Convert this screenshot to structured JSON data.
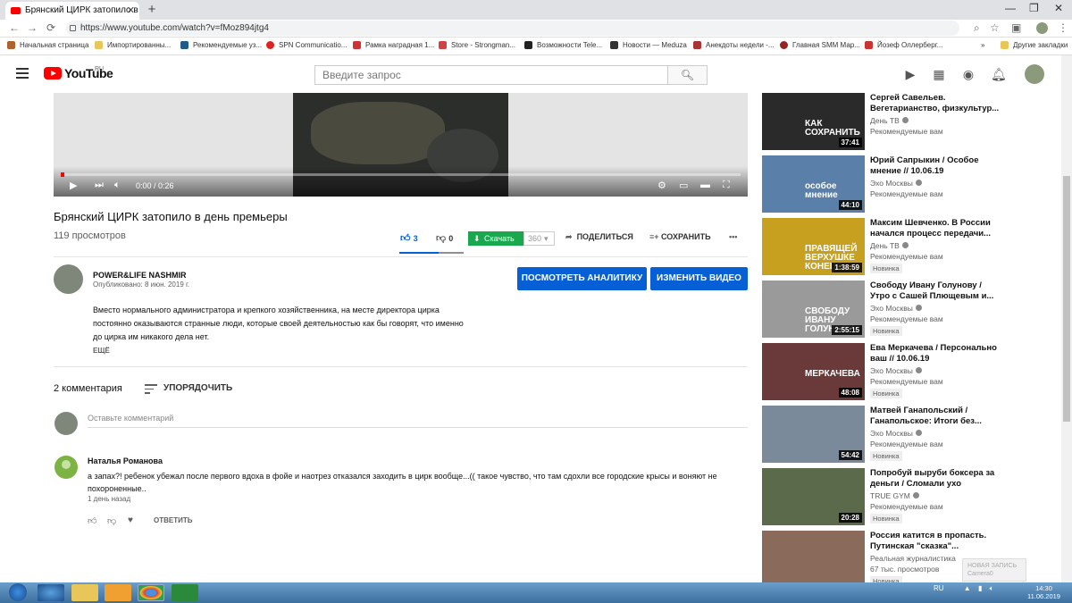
{
  "browser": {
    "tab_title": "Брянский ЦИРК затопило в день",
    "url": "https://www.youtube.com/watch?v=fMoz894jtg4",
    "bookmarks": [
      {
        "label": "Начальная страница",
        "color": "#b0622c"
      },
      {
        "label": "Импортированны...",
        "color": "#e8c65a"
      },
      {
        "label": "Рекомендуемые уз...",
        "color": "#1e5a8a"
      },
      {
        "label": "SPN Communicatio...",
        "color": "#d22"
      },
      {
        "label": "Рамка наградная 1...",
        "color": "#c33"
      },
      {
        "label": "Store - Strongman...",
        "color": "#c44"
      },
      {
        "label": "Возможности Tele...",
        "color": "#222"
      },
      {
        "label": "Новости — Meduza",
        "color": "#333"
      },
      {
        "label": "Анекдоты недели -...",
        "color": "#a33"
      },
      {
        "label": "Главная SMM Мар...",
        "color": "#922"
      },
      {
        "label": "Йозеф Оллерберг...",
        "color": "#c33"
      }
    ],
    "other_bookmarks": "Другие закладки"
  },
  "youtube": {
    "logo_text": "YouTube",
    "logo_region": "RU",
    "search_placeholder": "Введите запрос"
  },
  "player": {
    "time": "0:00 / 0:26",
    "progress_fraction": 0.0
  },
  "video": {
    "title": "Брянский ЦИРК затопило в день премьеры",
    "views": "119 просмотров",
    "likes": "3",
    "dislikes": "0",
    "download_label": "Скачать",
    "quality": "360",
    "share_label": "ПОДЕЛИТЬСЯ",
    "save_label": "СОХРАНИТЬ",
    "more_label": "•••"
  },
  "channel": {
    "name": "POWER&LIFE NASHMIR",
    "published": "Опубликовано: 8 июн. 2019 г.",
    "analytics_button": "ПОСМОТРЕТЬ АНАЛИТИКУ",
    "edit_button": "ИЗМЕНИТЬ ВИДЕО",
    "description": "Вместо нормального администратора и крепкого хозяйственника, на месте директора цирка постоянно оказываются странные люди, которые своей деятельностью как бы говорят, что именно до цирка им никакого дела нет.",
    "more": "ЕЩЁ"
  },
  "comments": {
    "count": "2 комментария",
    "sort_label": "УПОРЯДОЧИТЬ",
    "input_placeholder": "Оставьте комментарий",
    "items": [
      {
        "author": "Наталья Романова",
        "text": "а запах?! ребенок убежал после первого вдоха в фойе и  наотрез  отказался заходить в цирк вообще...(( такое чувство, что там сдохли все городские крысы и воняют не похороненные..",
        "time": "1 день назад",
        "reply": "ОТВЕТИТЬ"
      }
    ]
  },
  "sidebar": [
    {
      "title": "Сергей Савельев. Вегетарианство, физкультур...",
      "channel": "День ТВ",
      "verified": true,
      "meta": "Рекомендуемые вам",
      "badge": "",
      "duration": "37:41",
      "thumb_text": "КАК СОХРАНИТЬ",
      "thumb_color": "#2a2a2a"
    },
    {
      "title": "Юрий Сапрыкин / Особое мнение // 10.06.19",
      "channel": "Эхо Москвы",
      "verified": true,
      "meta": "Рекомендуемые вам",
      "badge": "",
      "duration": "44:10",
      "thumb_text": "особое мнение",
      "thumb_color": "#5a7fa8"
    },
    {
      "title": "Максим Шевченко. В России начался процесс передачи...",
      "channel": "День ТВ",
      "verified": true,
      "meta": "Рекомендуемые вам",
      "badge": "Новинка",
      "duration": "1:38:59",
      "thumb_text": "ПРАВЯЩЕЙ ВЕРХУШКЕ КОНЕЦ?",
      "thumb_color": "#c8a020"
    },
    {
      "title": "Свободу Ивану Голунову / Утро с Сашей Плющевым и...",
      "channel": "Эхо Москвы",
      "verified": true,
      "meta": "Рекомендуемые вам",
      "badge": "Новинка",
      "duration": "2:55:15",
      "thumb_text": "СВОБОДУ ИВАНУ ГОЛУНОВУ",
      "thumb_color": "#9a9a9a"
    },
    {
      "title": "Ева Меркачева / Персонально ваш // 10.06.19",
      "channel": "Эхо Москвы",
      "verified": true,
      "meta": "Рекомендуемые вам",
      "badge": "Новинка",
      "duration": "48:08",
      "thumb_text": "МЕРКАЧЕВА",
      "thumb_color": "#6a3a3a"
    },
    {
      "title": "Матвей Ганапольский / Ганапольское: Итоги без...",
      "channel": "Эхо Москвы",
      "verified": true,
      "meta": "Рекомендуемые вам",
      "badge": "Новинка",
      "duration": "54:42",
      "thumb_text": "",
      "thumb_color": "#7a8a9a"
    },
    {
      "title": "Попробуй выруби боксера за деньги / Сломали ухо",
      "channel": "TRUE GYM",
      "verified": true,
      "meta": "Рекомендуемые вам",
      "badge": "Новинка",
      "duration": "20:28",
      "thumb_text": "",
      "thumb_color": "#5a6a4a"
    },
    {
      "title": "Россия катится в пропасть. Путинская \"сказка\"...",
      "channel": "Реальная журналистика",
      "verified": false,
      "meta": "67 тыс. просмотров",
      "badge": "Новинка",
      "duration": "",
      "thumb_text": "",
      "thumb_color": "#8a6a5a"
    }
  ],
  "toast": {
    "line1": "НОВАЯ ЗАПИСЬ",
    "line2": "Camera0"
  },
  "taskbar": {
    "lang": "RU",
    "time": "14:30",
    "date": "11.06.2019"
  }
}
